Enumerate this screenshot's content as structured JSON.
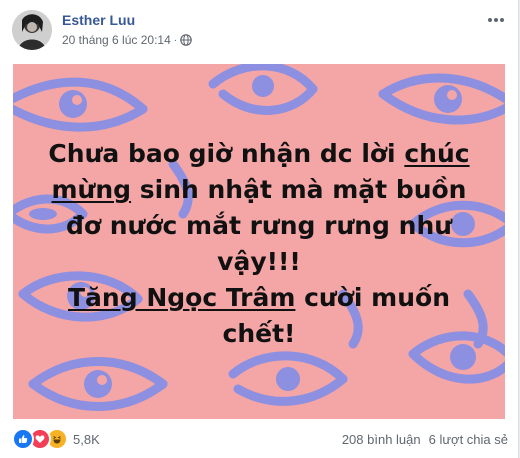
{
  "post": {
    "author": "Esther Luu",
    "timestamp": "20 tháng 6 lúc 20:14",
    "privacy_icon": "globe-icon",
    "more_icon": "more-options-icon",
    "image": {
      "background_color": "#f4a6a6",
      "doodle_color": "#8d8fe0",
      "lines": [
        {
          "before": "Chưa bao giờ nhận dc lời ",
          "underlined": "chúc",
          "after": ""
        },
        {
          "before": "",
          "underlined": "mừng",
          "after": " sinh nhật mà mặt buồn"
        },
        {
          "before": "đơ nước mắt rưng rưng như",
          "underlined": "",
          "after": ""
        },
        {
          "before": "vậy!!!",
          "underlined": "",
          "after": ""
        },
        {
          "before": "",
          "underlined": "Tăng Ngọc Trâm",
          "after": " cười muốn"
        },
        {
          "before": "chết!",
          "underlined": "",
          "after": ""
        }
      ]
    }
  },
  "footer": {
    "reaction_icons": [
      "like-icon",
      "love-icon",
      "haha-icon"
    ],
    "reaction_count": "5,8K",
    "comments": "208 bình luận",
    "shares": "6 lượt chia sẻ"
  },
  "colors": {
    "author_link": "#385898",
    "meta_text": "#616770",
    "like": "#1877f2",
    "love": "#f33e58",
    "haha": "#f7b125"
  }
}
